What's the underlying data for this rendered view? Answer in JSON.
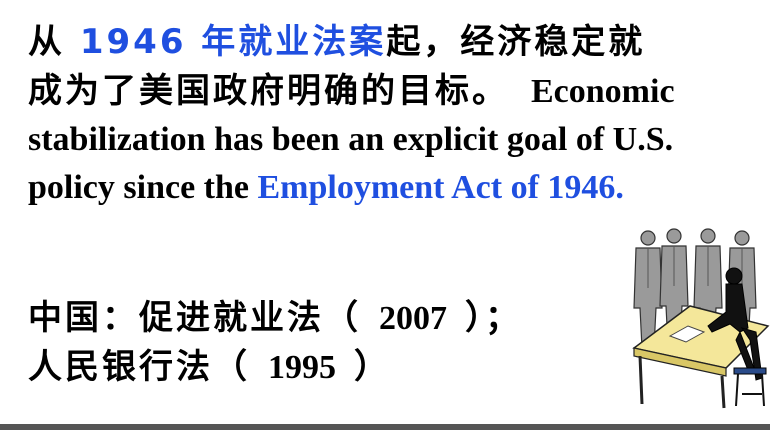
{
  "paragraph1": {
    "t1": "从 ",
    "t2": "1946 年就业法案",
    "t3": "起，经济稳定就成为了美国政府明确的目标。",
    "t4": "Economic stabilization has been an explicit goal of U.S. policy since the ",
    "t5": "Employment Act of 1946."
  },
  "paragraph2": {
    "line1_cjk": "中国：促进就业法（",
    "line1_num": "2007",
    "line1_end": "）；",
    "line2_cjk": "人民银行法（",
    "line2_num": "1995",
    "line2_end": "）"
  },
  "colors": {
    "accent_blue": "#1f4fe0",
    "text": "#000000"
  },
  "clipart": {
    "icon": "office-workers-clipart-icon"
  }
}
